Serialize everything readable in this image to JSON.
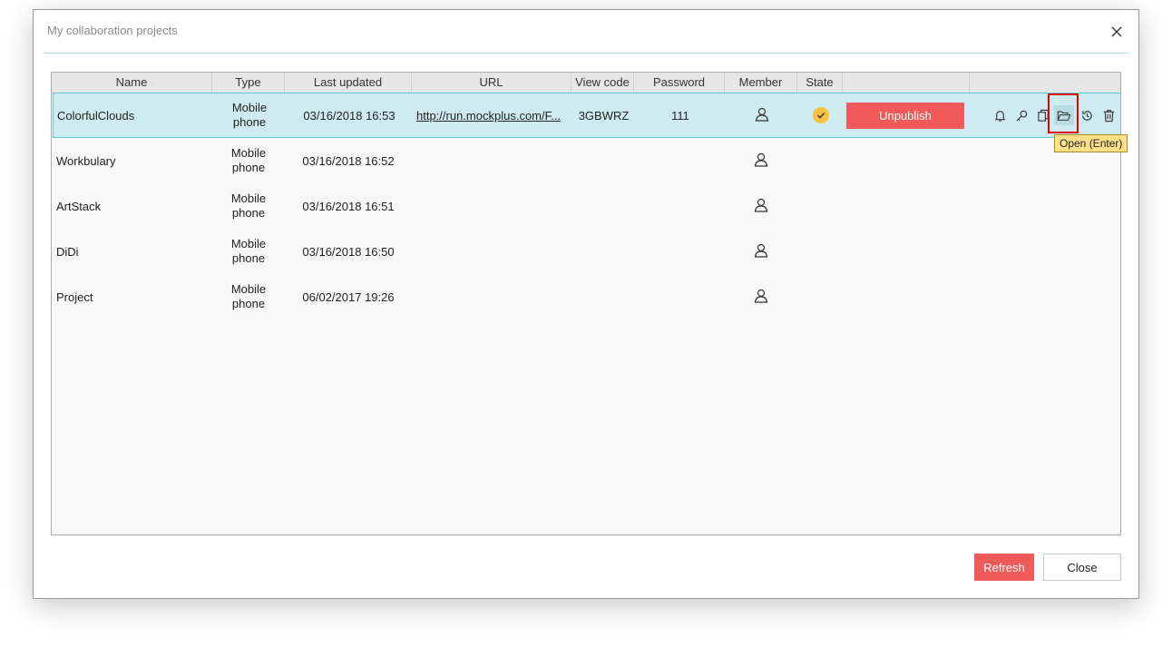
{
  "dialog": {
    "title": "My collaboration projects"
  },
  "columns": {
    "name": "Name",
    "type": "Type",
    "last_updated": "Last updated",
    "url": "URL",
    "view_code": "View code",
    "password": "Password",
    "member": "Member",
    "state": "State"
  },
  "rows": [
    {
      "name": "ColorfulClouds",
      "type": "Mobile phone",
      "updated": "03/16/2018 16:53",
      "url": "http://run.mockplus.com/F...",
      "view_code": "3GBWRZ",
      "password": "111",
      "published": true,
      "action": "Unpublish"
    },
    {
      "name": "Workbulary",
      "type": "Mobile phone",
      "updated": "03/16/2018 16:52"
    },
    {
      "name": "ArtStack",
      "type": "Mobile phone",
      "updated": "03/16/2018 16:51"
    },
    {
      "name": "DiDi",
      "type": "Mobile phone",
      "updated": "03/16/2018 16:50"
    },
    {
      "name": "Project",
      "type": "Mobile phone",
      "updated": "06/02/2017 19:26"
    }
  ],
  "row_actions": [
    "bell-icon",
    "key-icon",
    "copy-icon",
    "folder-open-icon",
    "history-icon",
    "trash-icon"
  ],
  "tooltip": "Open (Enter)",
  "buttons": {
    "refresh": "Refresh",
    "close": "Close"
  },
  "colors": {
    "accent": "#f15a5a",
    "selected_row": "#cdebf0",
    "selected_border": "#5ec6d5",
    "state_ok": "#f5c242",
    "tooltip_bg": "#ffe08a"
  }
}
